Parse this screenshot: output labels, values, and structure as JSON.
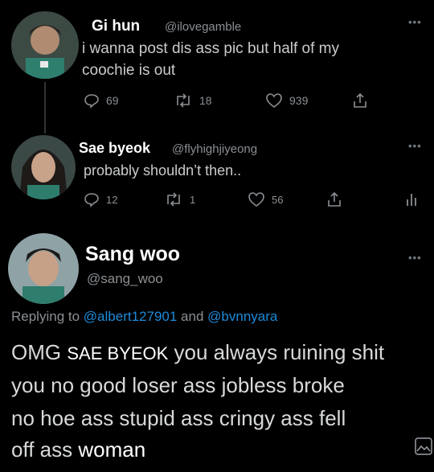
{
  "tweets": [
    {
      "name": "Gi hun",
      "handle": "@ilovegamble",
      "text_line1": "i wanna post dis ass pic but half of my",
      "text_line2": "coochie is out",
      "replies": "69",
      "retweets": "18",
      "likes": "939"
    },
    {
      "name": "Sae byeok",
      "handle": "@flyhighjiyeong",
      "text": "probably shouldn’t then..",
      "replies": "12",
      "retweets": "1",
      "likes": "56"
    }
  ],
  "main": {
    "name": "Sang woo",
    "handle": "@sang_woo",
    "replying_prefix": "Replying to",
    "replying_user1": "@albert127901",
    "replying_and": "and",
    "replying_user2": "@bvnnyara",
    "line1_a": "OMG",
    "line1_b": "SAE BYEOK",
    "line1_c": "you always ruining shit",
    "line2": "you no good loser ass jobless broke",
    "line3": "no hoe ass stupid ass cringy ass fell",
    "line4_a": "off ass",
    "line4_b": "woman"
  },
  "more_label": "•••",
  "colors": {
    "background": "#000000",
    "link": "#1d8ad9",
    "muted": "#8b8f93"
  }
}
